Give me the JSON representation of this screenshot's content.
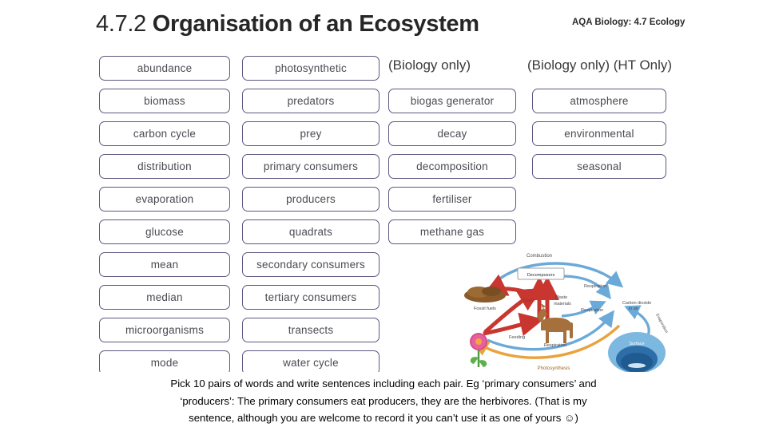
{
  "header": {
    "number": "4.7.2",
    "title": "Organisation of an Ecosystem",
    "spec_tag": "AQA Biology: 4.7 Ecology"
  },
  "columns": [
    {
      "heading": "",
      "words": [
        "abundance",
        "biomass",
        "carbon cycle",
        "distribution",
        "evaporation",
        "glucose",
        "mean",
        "median",
        "microorganisms",
        "mode"
      ]
    },
    {
      "heading": "",
      "words": [
        "photosynthetic",
        "predators",
        "prey",
        "primary consumers",
        "producers",
        "quadrats",
        "secondary consumers",
        "tertiary consumers",
        "transects",
        "water cycle"
      ]
    },
    {
      "heading": "(Biology only)",
      "words": [
        "biogas generator",
        "decay",
        "decomposition",
        "fertiliser",
        "methane gas"
      ]
    },
    {
      "heading": "(Biology only) (HT Only)",
      "words": [
        "atmosphere",
        "environmental",
        "seasonal"
      ]
    }
  ],
  "figure": {
    "name": "carbon-cycle-diagram",
    "labels": {
      "combustion": "Combustion",
      "decomposers": "Decomposers",
      "respiration_top": "Respiration",
      "respiration_mid": "Respiration",
      "respiration_animal": "Respiration",
      "death": "Death",
      "waste": "Waste materials",
      "feeding": "Feeding",
      "photosynthesis": "Photosynthesis",
      "fossil_fuels": "Fossil fuels",
      "carbon_dioxide": "Carbon dioxide in air",
      "seawater": "Surface",
      "evaporation": "Evaporation / Seawater"
    },
    "colors": {
      "blue_arrow": "#6aa9d8",
      "red_arrow": "#c8362f",
      "orange_arrow": "#e8a33d",
      "sea": "#7cb8e0",
      "sea_inner": "#2e6ea8",
      "soil": "#8a5a2b",
      "animal": "#a5703c",
      "flower": "#d94c8a"
    }
  },
  "caption": {
    "line1": "Pick 10 pairs of words and write sentences including each pair. Eg ‘primary consumers’ and",
    "line2": "‘producers’: The primary consumers eat producers, they are the herbivores. (That is my",
    "line3": "sentence, although you are welcome to record it you can’t use it as one of yours ☺)"
  },
  "theme": {
    "box_border": "#5f5580",
    "text": "#4a4a52",
    "title": "#262626"
  }
}
